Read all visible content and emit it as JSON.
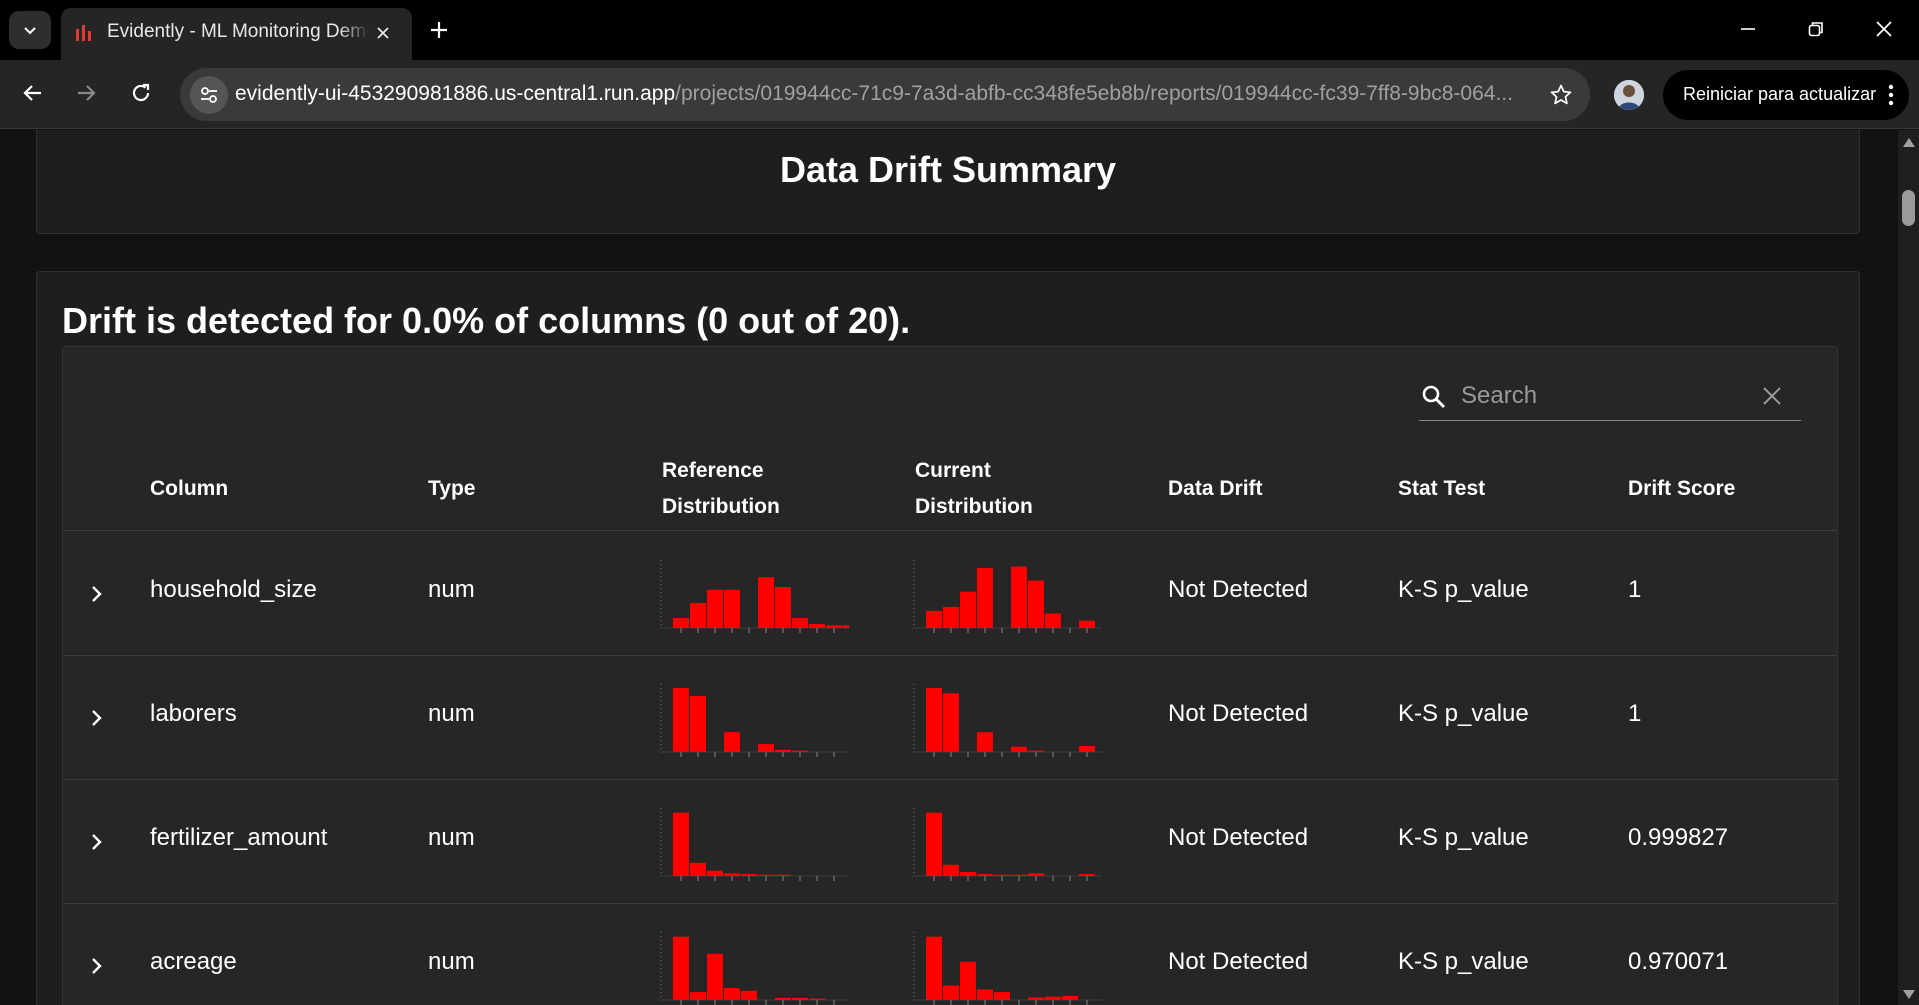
{
  "browser": {
    "tab_title": "Evidently - ML Monitoring Demo",
    "url_domain": "evidently-ui-453290981886.us-central1.run.app",
    "url_path": "/projects/019944cc-71c9-7a3d-abfb-cc348fe5eb8b/reports/019944cc-fc39-7ff8-9bc8-064...",
    "update_button": "Reiniciar para actualizar"
  },
  "page": {
    "summary_title": "Data Drift Summary",
    "drift_headline": "Drift is detected for 0.0% of columns (0 out of 20).",
    "search": {
      "placeholder": "Search",
      "value": ""
    },
    "columns": {
      "column": "Column",
      "type": "Type",
      "reference_1": "Reference",
      "reference_2": "Distribution",
      "current_1": "Current",
      "current_2": "Distribution",
      "data_drift": "Data Drift",
      "stat_test": "Stat Test",
      "drift_score": "Drift Score"
    },
    "rows": [
      {
        "column": "household_size",
        "type": "num",
        "data_drift": "Not Detected",
        "stat_test": "K-S p_value",
        "drift_score": "1",
        "reference_hist": [
          0.15,
          0.38,
          0.58,
          0.58,
          0,
          0.77,
          0.62,
          0.15,
          0.06,
          0.04,
          0.04
        ],
        "current_hist": [
          0.26,
          0.32,
          0.55,
          0.91,
          0,
          0.93,
          0.72,
          0.22,
          0,
          0.11,
          0
        ]
      },
      {
        "column": "laborers",
        "type": "num",
        "data_drift": "Not Detected",
        "stat_test": "K-S p_value",
        "drift_score": "1",
        "reference_hist": [
          0.97,
          0.85,
          0,
          0.3,
          0,
          0.12,
          0.03,
          0.02,
          0,
          0,
          0
        ],
        "current_hist": [
          0.97,
          0.89,
          0,
          0.3,
          0,
          0.08,
          0.02,
          0,
          0,
          0.09,
          0
        ]
      },
      {
        "column": "fertilizer_amount",
        "type": "num",
        "data_drift": "Not Detected",
        "stat_test": "K-S p_value",
        "drift_score": "0.999827",
        "reference_hist": [
          0.96,
          0.2,
          0.08,
          0.04,
          0.03,
          0.02,
          0.02,
          0,
          0,
          0,
          0
        ],
        "current_hist": [
          0.96,
          0.17,
          0.06,
          0.03,
          0.02,
          0.02,
          0.04,
          0,
          0,
          0.03,
          0
        ]
      },
      {
        "column": "acreage",
        "type": "num",
        "data_drift": "Not Detected",
        "stat_test": "K-S p_value",
        "drift_score": "0.970071",
        "reference_hist": [
          0.96,
          0.12,
          0.7,
          0.18,
          0.14,
          0,
          0.03,
          0.03,
          0.02,
          0,
          0
        ],
        "current_hist": [
          0.96,
          0.22,
          0.58,
          0.16,
          0.12,
          0,
          0.04,
          0.05,
          0.06,
          0,
          0
        ]
      }
    ]
  },
  "colors": {
    "bar": "#ff0000",
    "accent": "#e53935"
  },
  "icons": {
    "tab_menu": "chevron-down-icon",
    "favicon": "bar-chart-icon",
    "expand": "chevron-right-icon",
    "search": "search-icon",
    "clear": "close-icon"
  }
}
